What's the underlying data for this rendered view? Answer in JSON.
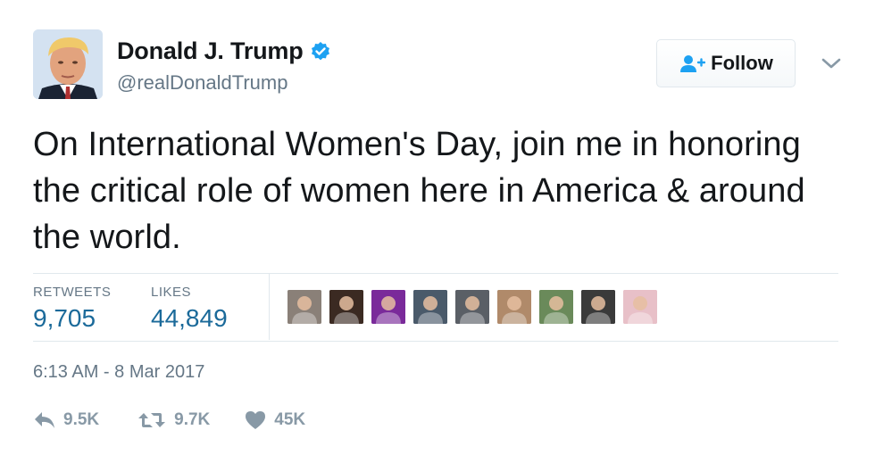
{
  "tweet": {
    "display_name": "Donald J. Trump",
    "handle": "@realDonaldTrump",
    "verified": true,
    "text": "On International Women's Day, join me in honoring the critical role of women here in America & around the world.",
    "timestamp": "6:13 AM - 8 Mar 2017"
  },
  "header": {
    "follow_label": "Follow"
  },
  "stats": {
    "retweets_label": "RETWEETS",
    "retweets_value": "9,705",
    "likes_label": "LIKES",
    "likes_value": "44,849"
  },
  "likers": [
    {
      "icon": "liker-avatar-1",
      "color": "#8a8078"
    },
    {
      "icon": "liker-avatar-2",
      "color": "#3b2a22"
    },
    {
      "icon": "liker-avatar-3",
      "color": "#7a2a9a"
    },
    {
      "icon": "liker-avatar-4",
      "color": "#4a5a6a"
    },
    {
      "icon": "liker-avatar-5",
      "color": "#5a5f66"
    },
    {
      "icon": "liker-avatar-6",
      "color": "#b08a6a"
    },
    {
      "icon": "liker-avatar-7",
      "color": "#6a8a5a"
    },
    {
      "icon": "liker-avatar-8",
      "color": "#3a3a3a"
    },
    {
      "icon": "liker-avatar-9",
      "color": "#e8c0c8"
    }
  ],
  "actions": {
    "reply_count": "9.5K",
    "retweet_count": "9.7K",
    "like_count": "45K"
  },
  "colors": {
    "verified_blue": "#1da1f2",
    "stat_value": "#1b6a9a",
    "muted": "#657786",
    "action_icon": "#8899a6"
  }
}
